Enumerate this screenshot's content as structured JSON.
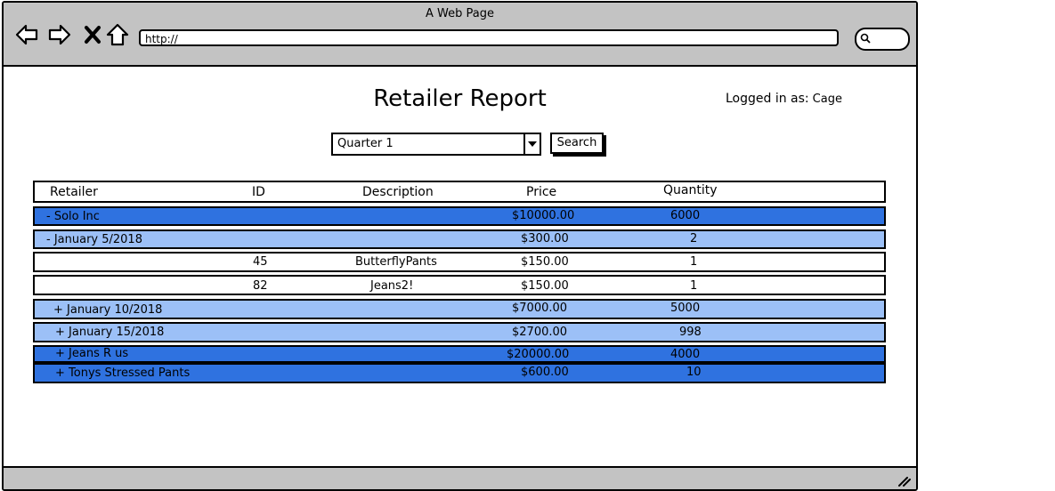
{
  "browser": {
    "title": "A Web Page",
    "url": "http://"
  },
  "page": {
    "title": "Retailer Report",
    "logged_in_label": "Logged in as:",
    "username": "Cage"
  },
  "filter": {
    "selected": "Quarter 1",
    "search_label": "Search"
  },
  "table": {
    "headers": {
      "retailer": "Retailer",
      "id": "ID",
      "description": "Description",
      "price": "Price",
      "quantity": "Quantity"
    },
    "rows": [
      {
        "level": "retailer",
        "retailer": "- Solo Inc",
        "id": "",
        "description": "",
        "price": "$10000.00",
        "quantity": "6000"
      },
      {
        "level": "date",
        "retailer": "- January 5/2018",
        "id": "",
        "description": "",
        "price": "$300.00",
        "quantity": "2"
      },
      {
        "level": "item",
        "retailer": "",
        "id": "45",
        "description": "ButterflyPants",
        "price": "$150.00",
        "quantity": "1"
      },
      {
        "level": "item",
        "retailer": "",
        "id": "82",
        "description": "Jeans2!",
        "price": "$150.00",
        "quantity": "1"
      },
      {
        "level": "date",
        "retailer": "+ January 10/2018",
        "id": "",
        "description": "",
        "price": "$7000.00",
        "quantity": "5000"
      },
      {
        "level": "date",
        "retailer": "+ January 15/2018",
        "id": "",
        "description": "",
        "price": "$2700.00",
        "quantity": "998"
      },
      {
        "level": "retailer",
        "retailer": "+ Jeans R us",
        "id": "",
        "description": "",
        "price": "$20000.00",
        "quantity": "4000"
      },
      {
        "level": "retailer",
        "retailer": "+ Tonys Stressed Pants",
        "id": "",
        "description": "",
        "price": "$600.00",
        "quantity": "10"
      }
    ]
  },
  "colors": {
    "chrome": "#c3c3c3",
    "retailer_row": "#2f72e0",
    "date_row": "#9cc0f7",
    "item_row": "#ffffff"
  }
}
